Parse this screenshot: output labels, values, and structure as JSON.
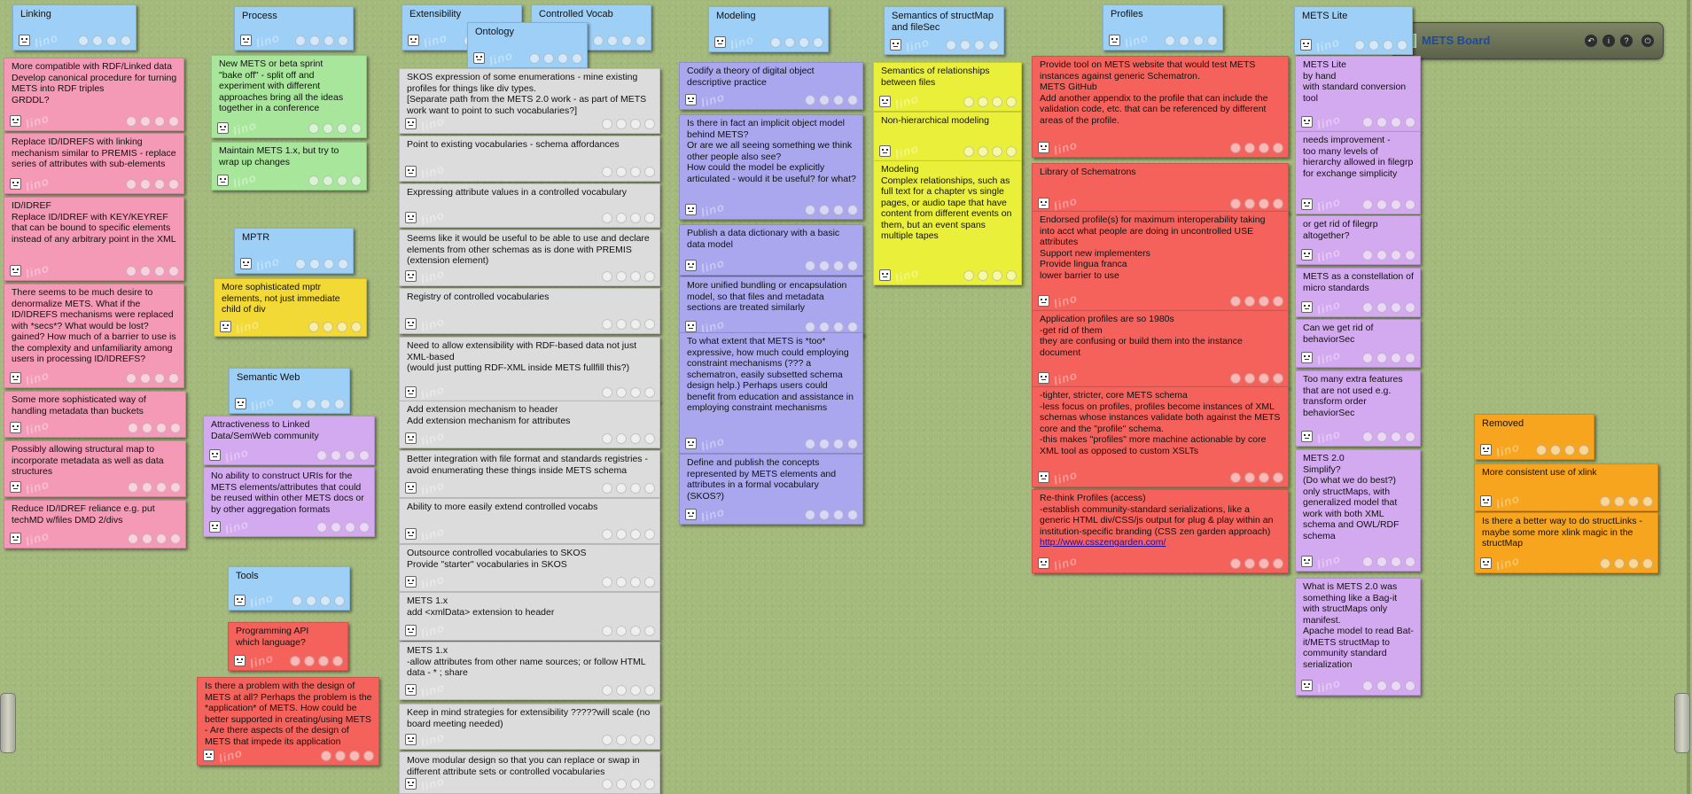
{
  "board": {
    "title": "METS Board",
    "watermark": "lino",
    "header_icons": [
      "back-icon",
      "info-icon",
      "help-icon",
      "power-icon"
    ],
    "header_glyphs": [
      "↶",
      "i",
      "?",
      "⏻"
    ]
  },
  "colors": {
    "blue": "#9ecff6",
    "green": "#a8e79b",
    "pink": "#f49ab6",
    "yellow": "#f2d935",
    "grey": "#dcdcdc",
    "lavender": "#aaa7ee",
    "lime": "#eaf03a",
    "red": "#f5625c",
    "violet": "#d3a9f0",
    "orange": "#f7a41e",
    "background": "#a4b97c"
  },
  "columns": {
    "linking": {
      "header": "Linking",
      "notes": [
        "More compatible with RDF/Linked data\nDevelop canonical procedure for turning METS into RDF triples\nGRDDL?",
        "Replace ID/IDREFS with linking mechanism similar to PREMIS - replace series of attributes with sub-elements",
        "ID/IDREF\nReplace ID/IDREF with KEY/KEYREF that can be bound to specific elements instead of any arbitrary point in the XML",
        "There seems to be much desire to denormalize METS.  What if the ID/IDREFS mechanisms were replaced with *secs*? What would be lost? gained? How much of a barrier to use is the complexity and unfamiliarity among users in processing ID/IDREFS?",
        "Some more sophisticated way of handling metadata than buckets",
        "Possibly allowing structural map to incorporate metadata as well as data structures",
        "Reduce ID/IDREF reliance e.g. put techMD w/files DMD 2/divs"
      ]
    },
    "process": {
      "header": "Process",
      "notes": [
        "New METS or beta sprint\n\"bake off\" - split off and experiment with different approaches bring all the ideas together in a conference",
        "Maintain METS 1.x, but try to wrap up changes"
      ]
    },
    "mptr": {
      "header": "MPTR",
      "notes": [
        "More sophisticated mptr elements, not just immediate child of div"
      ]
    },
    "semantic_web": {
      "header": "Semantic Web",
      "notes": [
        "Attractiveness to Linked Data/SemWeb community",
        "No ability to construct URIs for the METS elements/attributes that could be reused within other METS docs or by other aggregation formats"
      ]
    },
    "tools": {
      "header": "Tools",
      "notes": [
        "Programming API\nwhich language?",
        "Is there a problem with the design of METS at all? Perhaps the problem is the *application* of METS. How could be better supported in creating/using METS - Are there aspects of the design of METS that impede its application"
      ]
    },
    "extensibility": {
      "header": "Extensibility",
      "notes": [
        "SKOS expression of some enumerations - mine existing profiles for things like div types.\n[Separate path from the METS 2.0 work - as part of METS work want to point to such vocabularies?]",
        "Point to existing vocabularies - schema affordances",
        "Expressing attribute values in a controlled vocabulary",
        "Seems like it would be useful to be able to use and declare elements from other schemas as is done with PREMIS (extension element)",
        "Registry of controlled vocabularies",
        "Need to allow extensibility with RDF-based data not just XML-based\n(would just putting RDF-XML inside METS fullfill this?)",
        "Add extension mechanism to header\nAdd extension mechanism for attributes",
        "Better integration with file format and standards registries - avoid enumerating these things inside METS schema",
        "Ability to more easily extend controlled vocabs",
        "Outsource controlled vocabularies to SKOS\nProvide \"starter\" vocabularies in SKOS",
        "METS 1.x\nadd <xmlData> extension to header",
        "METS 1.x\n-allow attributes from other name sources; or follow HTML data - * ; share",
        "Keep in mind strategies for extensibility ?????will scale (no board meeting needed)",
        "Move modular design so that you can replace or swap in different attribute sets or controlled vocabularies"
      ]
    },
    "ontology": {
      "header": "Ontology"
    },
    "controlled_vocab": {
      "header": "Controlled Vocab"
    },
    "modeling": {
      "header": "Modeling",
      "notes": [
        "Codify a theory of digital object descriptive practice",
        "Is there in fact an implicit object model behind METS?\nOr are we all seeing something we think other people also see?\nHow could the model be explicitly articulated - would it be useful? for what?",
        "Publish a data dictionary with a basic data model",
        "More unified bundling or encapsulation model, so that files and metadata sections are treated similarly",
        "To what extent that METS is *too* expressive, how much could employing constraint mechanisms (??? a schematron, easily subsetted schema design help.) Perhaps users could benefit from education and assistance in employing constraint mechanisms",
        "Define and publish the concepts represented by METS elements and attributes in a formal vocabulary (SKOS?)"
      ]
    },
    "semantics": {
      "header": "Semantics of structMap and fileSec",
      "notes": [
        "Semantics of relationships between files",
        "Non-hierarchical modeling",
        "Modeling\nComplex relationships, such as full text for a chapter vs single pages, or audio tape that have content from different events on them, but an event spans multiple tapes"
      ]
    },
    "profiles": {
      "header": "Profiles",
      "notes": [
        "Provide tool on METS website that would test METS instances against generic Schematron.\nMETS GitHub\nAdd another appendix to the profile that can include the validation code, etc. that can be referenced by different areas of the profile.",
        "Library of Schematrons",
        "Endorsed profile(s) for maximum interoperability taking into acct what people are doing in uncontrolled USE attributes\nSupport new implementers\nProvide lingua franca\nlower barrier to use",
        "Application profiles are so 1980s\n-get rid of them\nthey are confusing or build them into the instance document",
        "-tighter, stricter, core METS schema\n-less focus on profiles, profiles become instances of XML schemas whose instances validate both against the METS core and the \"profile\" schema.\n-this makes \"profiles\" more machine actionable by core XML tool as opposed to custom XSLTs",
        "Re-think Profiles (access)\n-establish community-standard serializations, like a generic HTML div/CSS/js output for plug & play within an institution-specific branding (CSS zen garden approach)"
      ],
      "link": "http://www.csszengarden.com/"
    },
    "mets_lite": {
      "header": "METS Lite",
      "notes": [
        "METS Lite\nby hand\nwith standard conversion tool",
        "needs improvement -\n   too many levels of hierarchy allowed in filegrp for exchange simplicity",
        "or get rid of filegrp altogether?",
        "METS as a constellation of micro standards",
        "Can we get rid of behaviorSec",
        "Too many extra features that are not used e.g. transform order behaviorSec",
        "METS 2.0\nSimplify?\n(Do what we do best?)\nonly structMaps, with generalized model that work with both XML schema and OWL/RDF schema",
        "What is METS 2.0 was something like a Bag-it with structMaps only manifest.\nApache model to read Bat-it/METS structMap to community standard serialization"
      ]
    },
    "removed": {
      "header": "Removed",
      "notes": [
        "More consistent use of xlink",
        "Is there a better way to do structLinks - maybe some more xlink magic in the structMap"
      ]
    }
  }
}
